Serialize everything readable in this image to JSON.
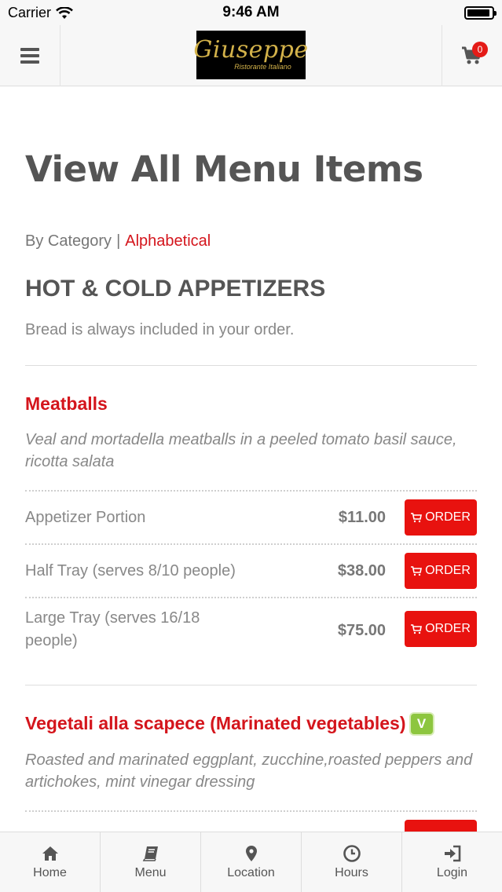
{
  "status_bar": {
    "carrier": "Carrier",
    "time": "9:46 AM"
  },
  "header": {
    "logo_name": "Giuseppe",
    "logo_subtitle": "Ristorante Italiano",
    "cart_count": "0"
  },
  "page": {
    "title": "View All Menu Items",
    "sort_by_category": "By Category",
    "sort_separator": "|",
    "sort_alphabetical": "Alphabetical"
  },
  "category": {
    "title": "HOT & COLD APPETIZERS",
    "note": "Bread is always included in your order."
  },
  "items": [
    {
      "name": "Meatballs",
      "description": "Veal and mortadella meatballs in a peeled tomato basil sauce, ricotta salata",
      "prices": [
        {
          "label": "Appetizer Portion",
          "price": "$11.00",
          "button": "ORDER"
        },
        {
          "label": "Half Tray (serves 8/10 people)",
          "price": "$38.00",
          "button": "ORDER"
        },
        {
          "label": "Large Tray (serves 16/18 people)",
          "price": "$75.00",
          "button": "ORDER"
        }
      ]
    },
    {
      "name": "Vegetali alla scapece (Marinated vegetables)",
      "badge": "V",
      "description": "Roasted and marinated eggplant, zucchine,roasted peppers and artichokes, mint vinegar dressing"
    }
  ],
  "tabbar": [
    {
      "label": "Home",
      "icon": "home-icon"
    },
    {
      "label": "Menu",
      "icon": "book-icon"
    },
    {
      "label": "Location",
      "icon": "map-marker-icon"
    },
    {
      "label": "Hours",
      "icon": "clock-icon"
    },
    {
      "label": "Login",
      "icon": "sign-in-icon"
    }
  ],
  "colors": {
    "accent": "#d4151c",
    "order_button": "#e8120f",
    "veg_badge": "#8dc63f"
  }
}
